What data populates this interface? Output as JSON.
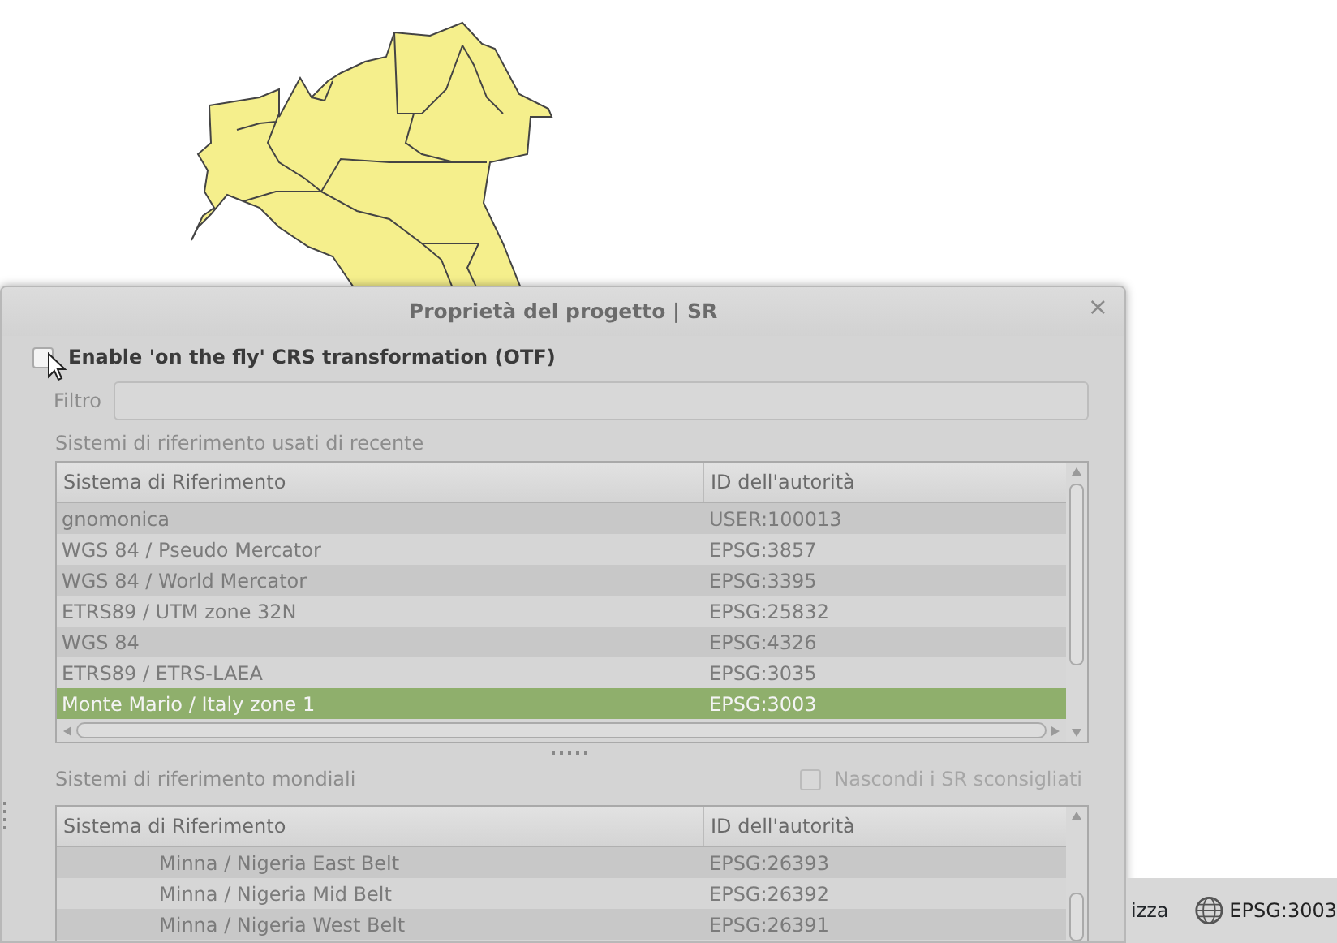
{
  "dialog": {
    "title": "Proprietà del progetto | SR",
    "close": "×",
    "otf": {
      "label": "Enable 'on the fly' CRS transformation (OTF)",
      "checked": false
    },
    "filter": {
      "label": "Filtro"
    },
    "recent": {
      "label": "Sistemi di riferimento usati di recente",
      "columns": [
        "Sistema di Riferimento",
        "ID dell'autorità"
      ],
      "rows": [
        {
          "name": "gnomonica",
          "authority": "USER:100013",
          "selected": false
        },
        {
          "name": "WGS 84 / Pseudo Mercator",
          "authority": "EPSG:3857",
          "selected": false
        },
        {
          "name": "WGS 84 / World Mercator",
          "authority": "EPSG:3395",
          "selected": false
        },
        {
          "name": "ETRS89 / UTM zone 32N",
          "authority": "EPSG:25832",
          "selected": false
        },
        {
          "name": "WGS 84",
          "authority": "EPSG:4326",
          "selected": false
        },
        {
          "name": "ETRS89 / ETRS-LAEA",
          "authority": "EPSG:3035",
          "selected": false
        },
        {
          "name": "Monte Mario / Italy zone 1",
          "authority": "EPSG:3003",
          "selected": true
        }
      ]
    },
    "world": {
      "label": "Sistemi di riferimento mondiali",
      "hide_deprecated": {
        "label": "Nascondi i SR sconsigliati",
        "checked": false
      },
      "columns": [
        "Sistema di Riferimento",
        "ID dell'autorità"
      ],
      "rows": [
        {
          "name": "Minna / Nigeria East Belt",
          "authority": "EPSG:26393",
          "selected": false
        },
        {
          "name": "Minna / Nigeria Mid Belt",
          "authority": "EPSG:26392",
          "selected": false
        },
        {
          "name": "Minna / Nigeria West Belt",
          "authority": "EPSG:26391",
          "selected": false
        }
      ]
    }
  },
  "status_bar": {
    "partial_label": "izza",
    "crs": "EPSG:3003"
  }
}
